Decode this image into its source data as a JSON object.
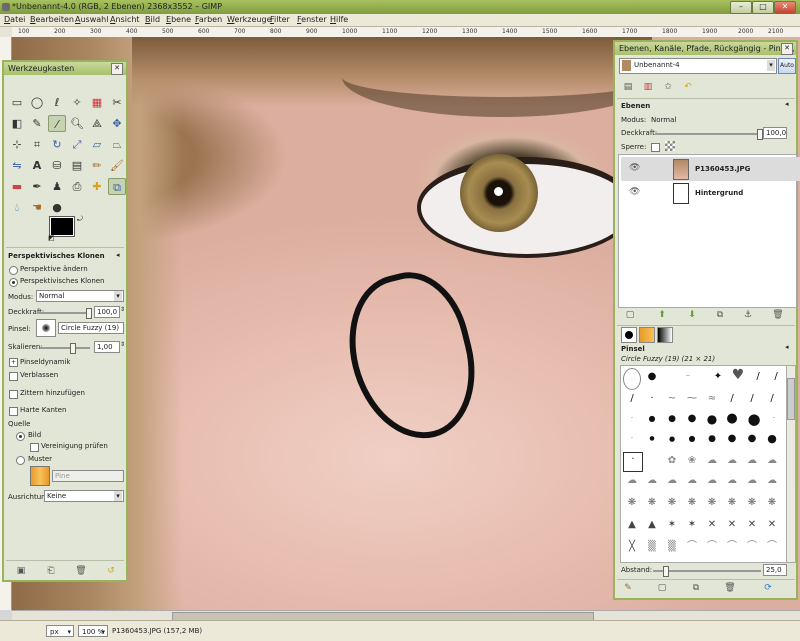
{
  "window": {
    "title": "*Unbenannt-4.0 (RGB, 2 Ebenen) 2368x3552 – GIMP"
  },
  "menu": [
    "Datei",
    "Bearbeiten",
    "Auswahl",
    "Ansicht",
    "Bild",
    "Ebene",
    "Farben",
    "Werkzeuge",
    "Filter",
    "Fenster",
    "Hilfe"
  ],
  "ruler": {
    "h_ticks": [
      "100",
      "200",
      "300",
      "400",
      "500",
      "600",
      "700",
      "800",
      "900",
      "1000",
      "1100",
      "1200",
      "1300",
      "1400",
      "1500",
      "1600",
      "1700",
      "1800",
      "1900",
      "2000",
      "2100",
      "2200"
    ]
  },
  "status": {
    "unit": "px",
    "zoom": "100 %",
    "info": "P1360453.JPG (157,2 MB)"
  },
  "toolbox": {
    "title": "Werkzeugkasten",
    "tool_options_title": "Perspektivisches Klonen",
    "radio_change": "Perspektive ändern",
    "radio_clone": "Perspektivisches Klonen",
    "mode_label": "Modus:",
    "mode_value": "Normal",
    "opacity_label": "Deckkraft:",
    "opacity_value": "100,0",
    "brush_label": "Pinsel:",
    "brush_value": "Circle Fuzzy (19)",
    "scale_label": "Skalieren:",
    "scale_value": "1,00",
    "dynamics_label": "Pinseldynamik",
    "fade_label": "Verblassen",
    "jitter_label": "Zittern hinzufügen",
    "hard_edges_label": "Harte Kanten",
    "source_label": "Quelle",
    "source_image": "Bild",
    "sample_merged": "Vereinigung prüfen",
    "source_pattern": "Muster",
    "pattern_value": "Pine",
    "alignment_label": "Ausrichtung:",
    "alignment_value": "Keine"
  },
  "dock": {
    "title": "Ebenen, Kanäle, Pfade, Rückgängig - Pinsel, Mus...",
    "image_selector": "Unbenannt-4",
    "auto_label": "Auto",
    "layers_title": "Ebenen",
    "mode_label": "Modus:",
    "mode_value": "Normal",
    "opacity_label": "Deckkraft:",
    "opacity_value": "100,0",
    "lock_label": "Sperre:",
    "layers": [
      {
        "name": "P1360453.JPG"
      },
      {
        "name": "Hintergrund"
      }
    ],
    "brushes_title": "Pinsel",
    "brush_info": "Circle Fuzzy (19) (21 × 21)",
    "spacing_label": "Abstand:",
    "spacing_value": "25,0"
  },
  "colors": {
    "title_bar": "#8fae4c",
    "panel_border": "#9bb25c",
    "selection_highlight": "#c6d3b0"
  }
}
